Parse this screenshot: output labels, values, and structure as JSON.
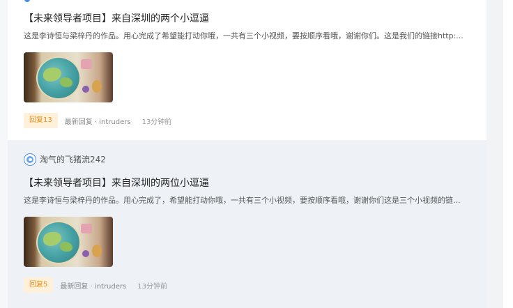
{
  "posts": [
    {
      "author": "",
      "title": "【未来领导者项目】来自深圳的两个小逗逼",
      "excerpt": "这是李诗恒与梁梓丹的作品。用心完成了希望能打动你哦，一共有三个小视频，要按顺序看哦，谢谢你们。这是我们的链接http:...",
      "reply_badge": "回复13",
      "last_reply": "最新回复 · intruders",
      "time": "13分钟前"
    },
    {
      "author": "淘气的飞猪流242",
      "title": "【未来领导者项目】来自深圳的两位小逗逼",
      "excerpt": "这是李诗恒与梁梓丹的作品。用心完成了，希望能打动你哦，一共有三个小视频，要按顺序看哦，谢谢你们这是三个小视频的链...",
      "reply_badge": "回复5",
      "last_reply": "最新回复 · intruders",
      "time": "13分钟前"
    }
  ],
  "colors": {
    "accent": "#4a90e2",
    "reply_badge_bg": "#fff1d9",
    "reply_badge_text": "#e58e1a",
    "highlight_row_bg": "#eef2f6"
  },
  "icons": {
    "avatar": "avatar-icon"
  }
}
